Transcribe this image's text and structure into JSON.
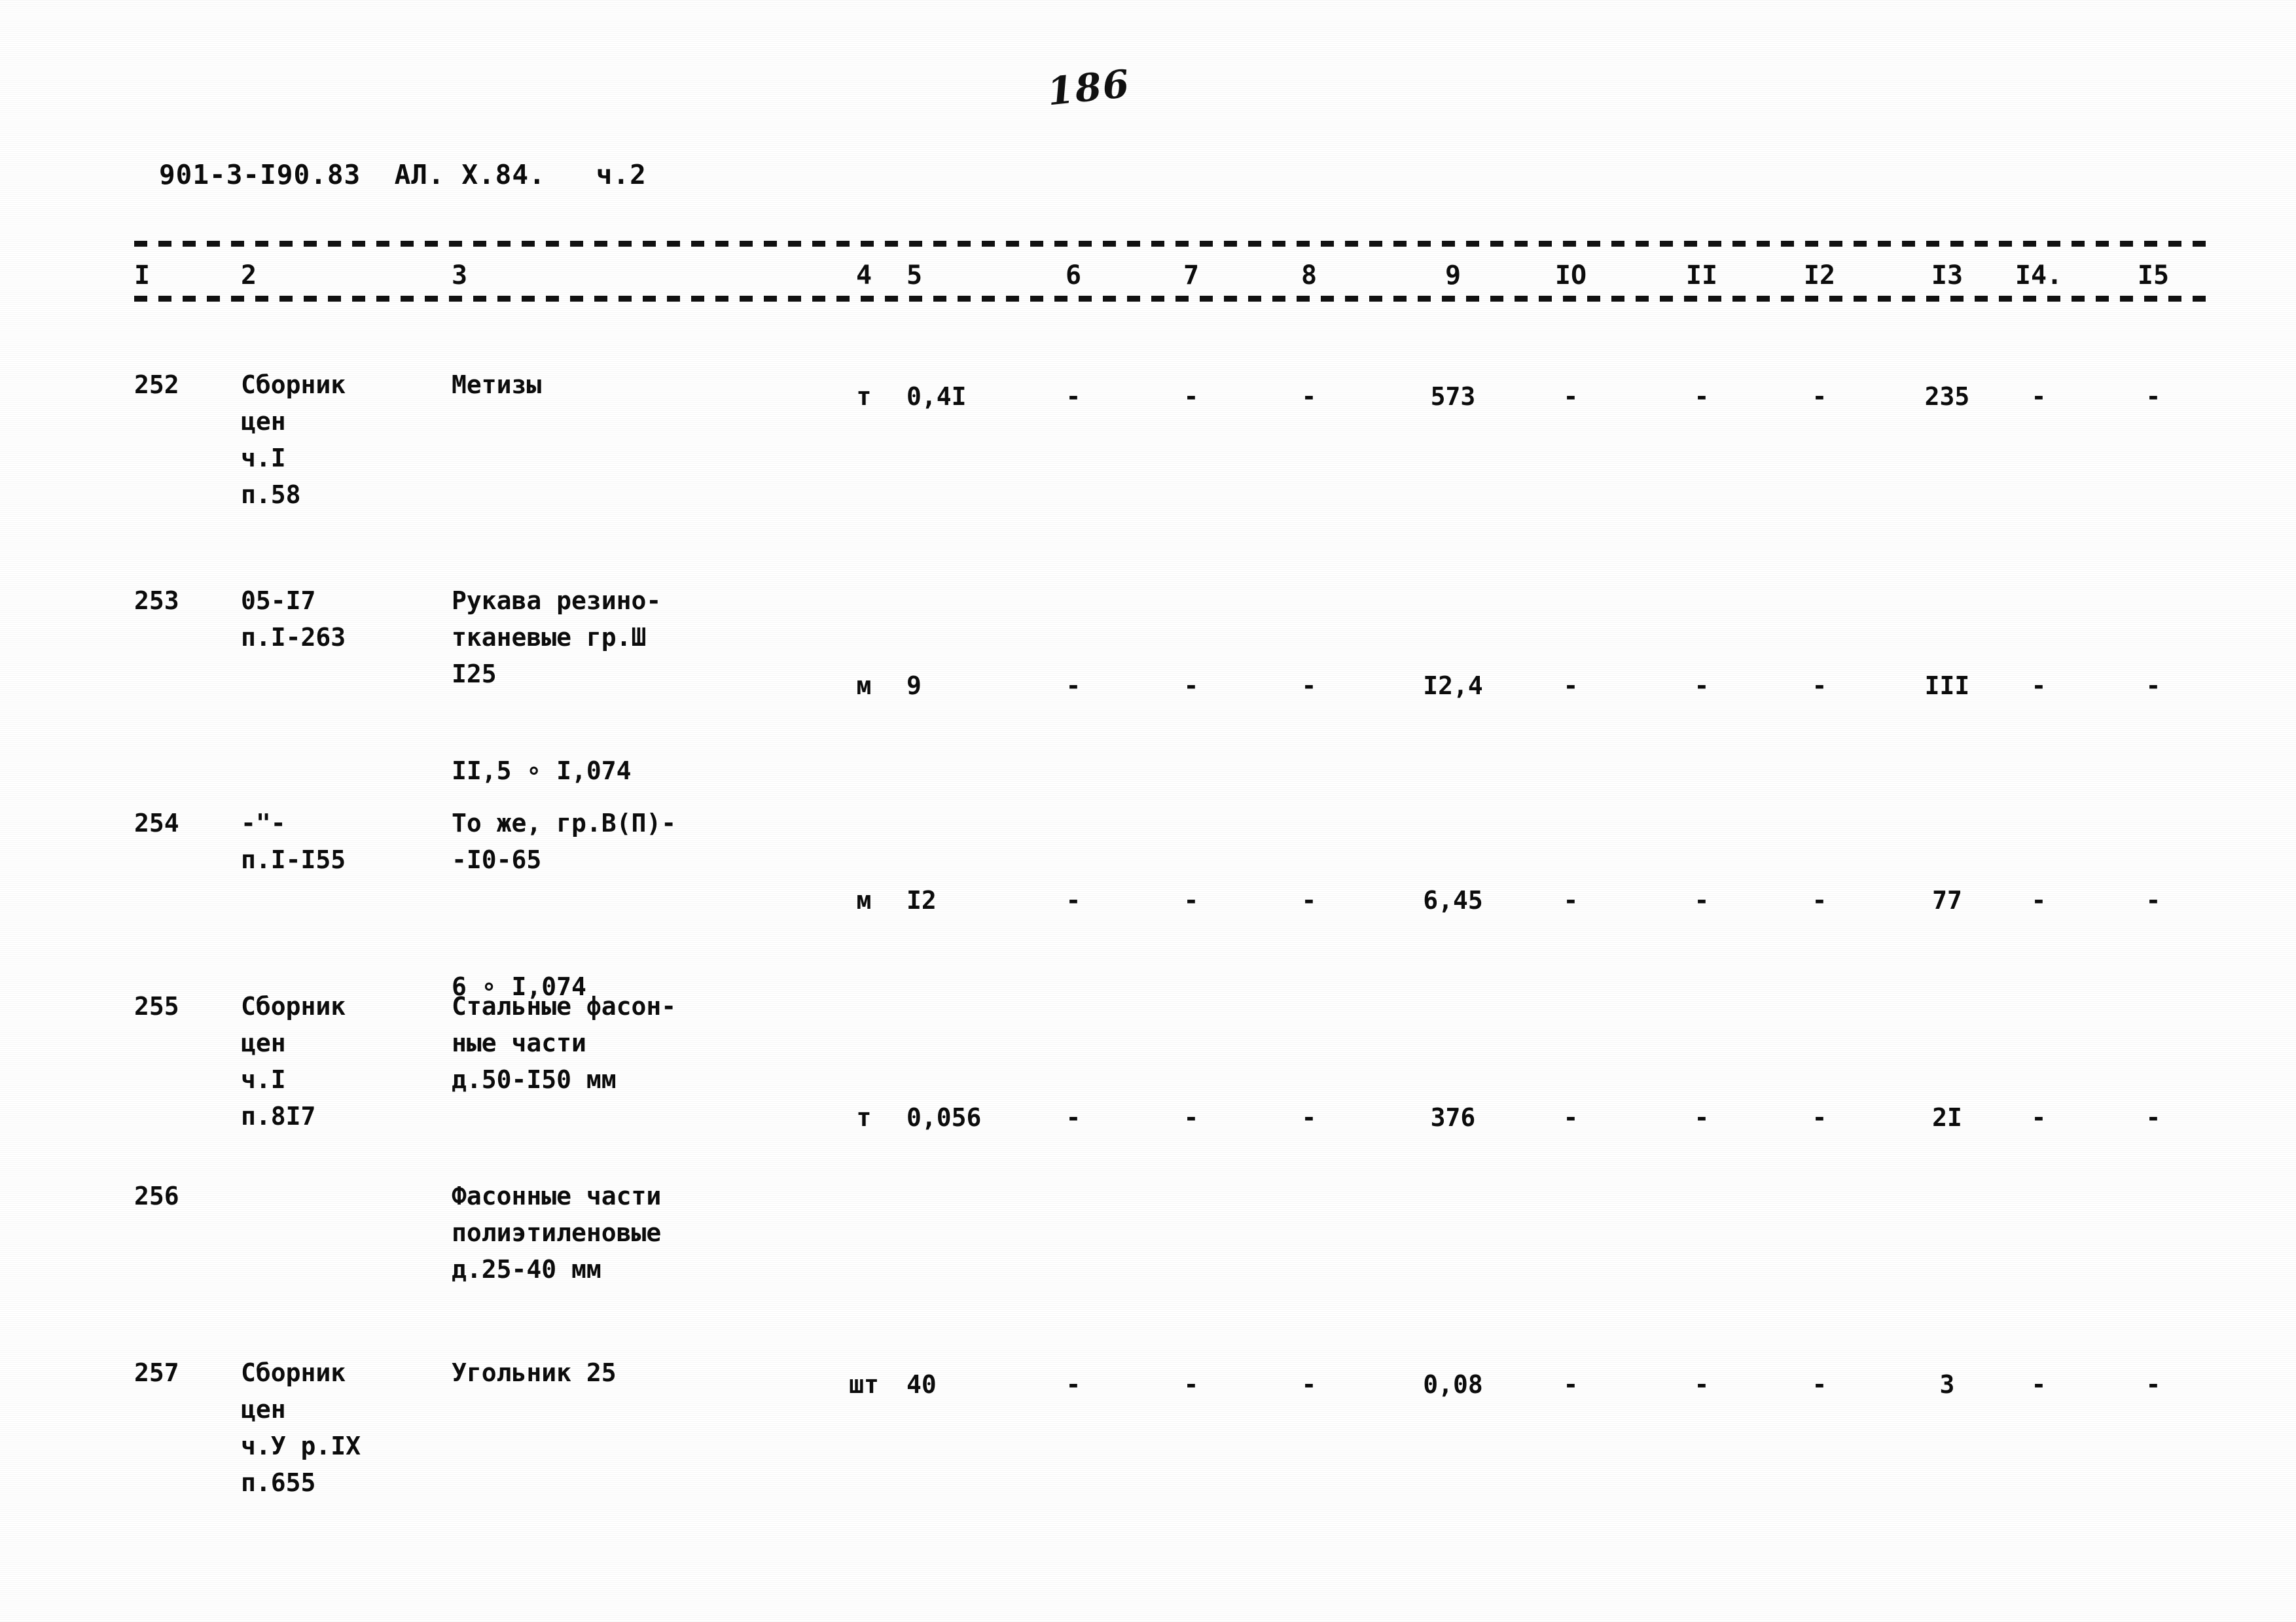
{
  "page": {
    "page_number": "186",
    "doc_code": "901-3-I90.83  АЛ. Х.84.   ч.2"
  },
  "table": {
    "column_numbers": [
      "I",
      "2",
      "3",
      "4",
      "5",
      "6",
      "7",
      "8",
      "9",
      "IO",
      "II",
      "I2",
      "I3",
      "I4.",
      "I5"
    ],
    "dash": "-",
    "rows": [
      {
        "num": "252",
        "justification": "Сборник\nцен\nч.I\nп.58",
        "name": "Метизы",
        "unit": "т",
        "qty": "0,4I",
        "c6": "-",
        "c7": "-",
        "c8": "-",
        "c9": "573",
        "c10": "-",
        "c11": "-",
        "c12": "-",
        "c13": "235",
        "c14": "-",
        "c15": "-"
      },
      {
        "num": "253",
        "justification": "05-I7\nп.I-263",
        "name": "Рукава резино-\nтканевые гр.Ш\nI25",
        "name_extra": "II,5 ∘ I,074",
        "unit": "м",
        "qty": "9",
        "c6": "-",
        "c7": "-",
        "c8": "-",
        "c9": "I2,4",
        "c10": "-",
        "c11": "-",
        "c12": "-",
        "c13": "III",
        "c14": "-",
        "c15": "-"
      },
      {
        "num": "254",
        "justification": "-\"-\nп.I-I55",
        "name": "То же, гр.В(П)-\n-I0-65",
        "name_extra": "6 ∘ I,074",
        "unit": "м",
        "qty": "I2",
        "c6": "-",
        "c7": "-",
        "c8": "-",
        "c9": "6,45",
        "c10": "-",
        "c11": "-",
        "c12": "-",
        "c13": "77",
        "c14": "-",
        "c15": "-"
      },
      {
        "num": "255",
        "justification": "Сборник\nцен\nч.I\nп.8I7",
        "name": "Стальные фасон-\nные части\nд.50-I50 мм",
        "unit": "т",
        "qty": "0,056",
        "c6": "-",
        "c7": "-",
        "c8": "-",
        "c9": "376",
        "c10": "-",
        "c11": "-",
        "c12": "-",
        "c13": "2I",
        "c14": "-",
        "c15": "-"
      },
      {
        "num": "256",
        "justification": "",
        "name": "Фасонные части\nполиэтиленовые\nд.25-40 мм",
        "unit": "",
        "qty": "",
        "c6": "",
        "c7": "",
        "c8": "",
        "c9": "",
        "c10": "",
        "c11": "",
        "c12": "",
        "c13": "",
        "c14": "",
        "c15": ""
      },
      {
        "num": "257",
        "justification": "Сборник\nцен\nч.У р.IX\nп.655",
        "name": "Угольник 25",
        "unit": "шт",
        "qty": "40",
        "c6": "-",
        "c7": "-",
        "c8": "-",
        "c9": "0,08",
        "c10": "-",
        "c11": "-",
        "c12": "-",
        "c13": "3",
        "c14": "-",
        "c15": "-"
      }
    ]
  }
}
